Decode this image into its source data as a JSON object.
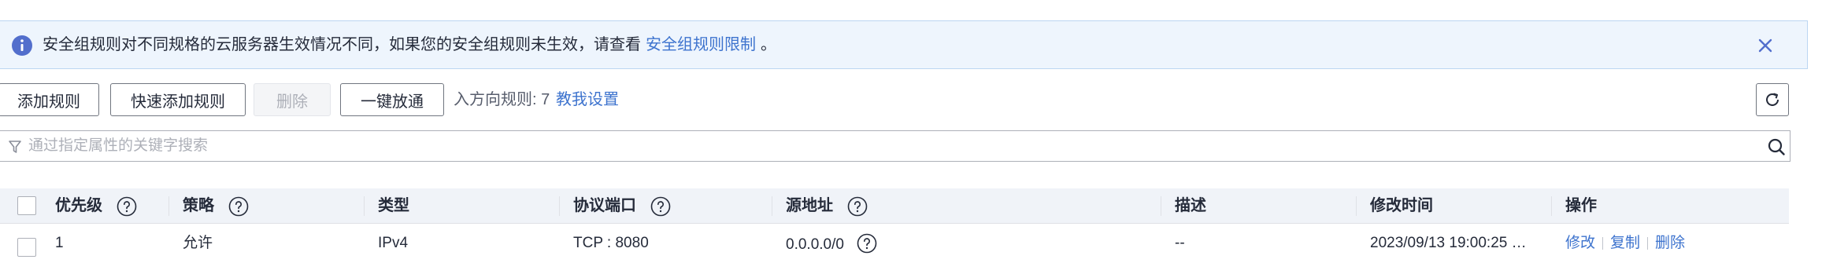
{
  "banner": {
    "message": "安全组规则对不同规格的云服务器生效情况不同，如果您的安全组规则未生效，请查看",
    "link": "安全组规则限制",
    "tail": "。",
    "icon": "info-icon",
    "close_icon": "close-icon"
  },
  "toolbar": {
    "add_rule": "添加规则",
    "quick_add_rule": "快速添加规则",
    "delete": "删除",
    "one_click_allow": "一键放通",
    "rule_count": "入方向规则: 7",
    "tutorial": "教我设置",
    "refresh_icon": "refresh-icon"
  },
  "search": {
    "placeholder": "通过指定属性的关键字搜索",
    "value": ""
  },
  "table": {
    "columns": {
      "priority": "优先级",
      "policy": "策略",
      "type": "类型",
      "protocol_port": "协议端口",
      "source": "源地址",
      "description": "描述",
      "modified": "修改时间",
      "actions": "操作"
    },
    "rows": [
      {
        "priority": "1",
        "policy": "允许",
        "type": "IPv4",
        "protocol_port": "TCP : 8080",
        "source": "0.0.0.0/0",
        "description": "--",
        "modified": "2023/09/13 19:00:25 G…",
        "actions": {
          "edit": "修改",
          "copy": "复制",
          "delete": "删除"
        }
      }
    ]
  },
  "colors": {
    "accent": "#3d73ce",
    "banner_bg": "#eef5fd",
    "header_bg": "#f0f3f8"
  }
}
